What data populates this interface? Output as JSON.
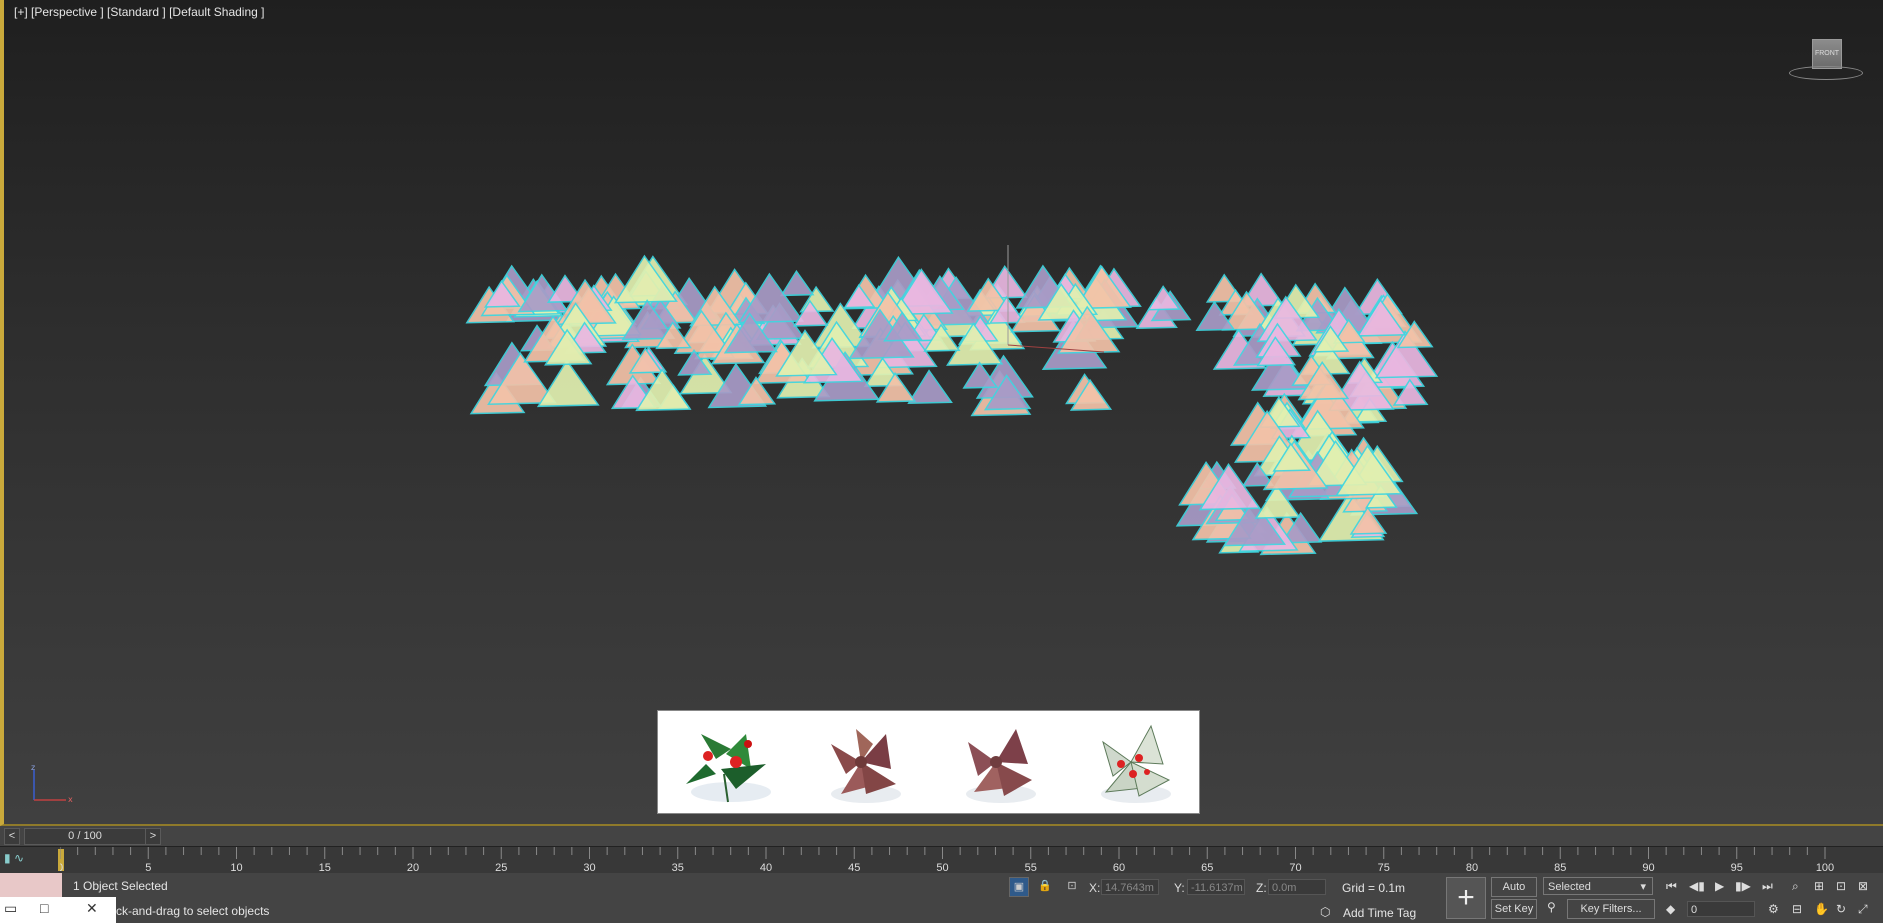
{
  "viewport": {
    "label": "[+] [Perspective ] [Standard ] [Default Shading ]",
    "viewcube_face": "FRONT"
  },
  "time_slider": {
    "prev": "<",
    "next": ">",
    "counter": "0 / 100"
  },
  "trackbar": {
    "ticks": [
      "0",
      "5",
      "10",
      "15",
      "20",
      "25",
      "30",
      "35",
      "40",
      "45",
      "50",
      "55",
      "60",
      "65",
      "70",
      "75",
      "80",
      "85",
      "90",
      "95",
      "100"
    ]
  },
  "status": {
    "selection": "1 Object Selected",
    "prompt": "ck-and-drag to select objects",
    "x_label": "X:",
    "x_value": "14.7643m",
    "y_label": "Y:",
    "y_value": "-11.6137m",
    "z_label": "Z:",
    "z_value": "0.0m",
    "grid": "Grid = 0.1m",
    "add_time_tag": "Add Time Tag"
  },
  "animation": {
    "auto_key": "Auto Key",
    "set_key": "Set Key",
    "selected": "Selected",
    "key_filters": "Key Filters...",
    "frame": "0"
  },
  "colors": {
    "accent": "#c9a93b",
    "outline": "#3fd6e0",
    "leaf_peach": "#f3c2a8",
    "leaf_pink": "#e9b7e1",
    "leaf_purple": "#a89bc7",
    "leaf_lime": "#e1f0b0"
  }
}
